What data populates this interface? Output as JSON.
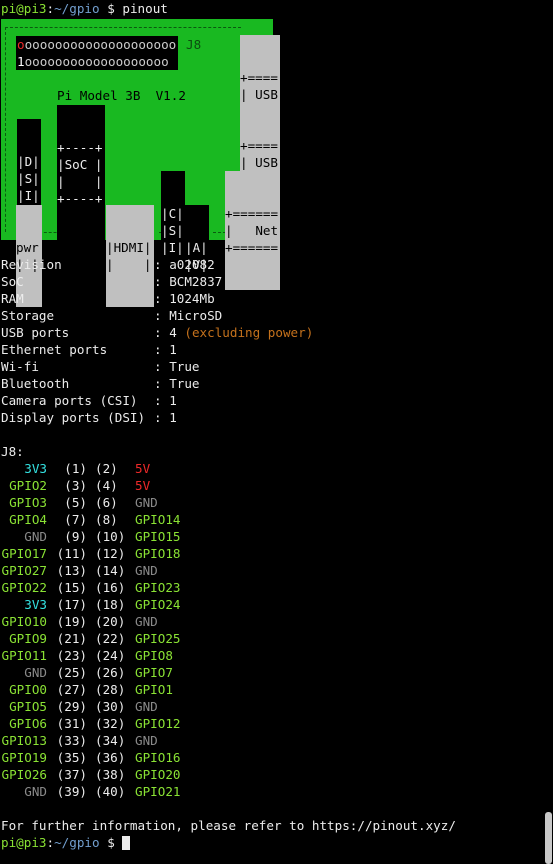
{
  "prompt": {
    "user": "pi@pi3",
    "path": "~/gpio",
    "symbol": "$",
    "command": "pinout"
  },
  "board": {
    "header_label": "J8",
    "top_row_pins": "oooooooooooooooooooo",
    "bottom_row_first": "1",
    "bottom_row_pins": "ooooooooooooooooooo",
    "model": "Pi Model 3B  V1.2",
    "soc_box": [
      "+----+",
      "|SoC |",
      "|    |",
      "+----+"
    ],
    "dsi_box": [
      "|D|",
      "|S|",
      "|I|"
    ],
    "csi_box": [
      "|C|",
      "|S|",
      "|I|"
    ],
    "av_box": [
      "|A|",
      "|V|"
    ],
    "usb_top": [
      "+====",
      "| USB",
      "+===="
    ],
    "usb_bottom": [
      "+====",
      "| USB",
      "+===="
    ],
    "net": [
      "+======",
      "|   Net",
      "+======"
    ],
    "pwr": [
      "pwr",
      "| |"
    ],
    "hdmi": [
      "|HDMI|",
      "|    |"
    ]
  },
  "info": [
    {
      "key": "Revision",
      "value": "a02082"
    },
    {
      "key": "SoC",
      "value": "BCM2837"
    },
    {
      "key": "RAM",
      "value": "1024Mb"
    },
    {
      "key": "Storage",
      "value": "MicroSD"
    },
    {
      "key": "USB ports",
      "value": "4",
      "note": "(excluding power)"
    },
    {
      "key": "Ethernet ports",
      "value": "1"
    },
    {
      "key": "Wi-fi",
      "value": "True"
    },
    {
      "key": "Bluetooth",
      "value": "True"
    },
    {
      "key": "Camera ports (CSI)",
      "value": "1"
    },
    {
      "key": "Display ports (DSI)",
      "value": "1"
    }
  ],
  "info_separator": ":",
  "j8_title": "J8:",
  "pins": [
    {
      "left": "3V3",
      "l_num": "(1)",
      "r_num": "(2)",
      "right": "5V"
    },
    {
      "left": "GPIO2",
      "l_num": "(3)",
      "r_num": "(4)",
      "right": "5V"
    },
    {
      "left": "GPIO3",
      "l_num": "(5)",
      "r_num": "(6)",
      "right": "GND"
    },
    {
      "left": "GPIO4",
      "l_num": "(7)",
      "r_num": "(8)",
      "right": "GPIO14"
    },
    {
      "left": "GND",
      "l_num": "(9)",
      "r_num": "(10)",
      "right": "GPIO15"
    },
    {
      "left": "GPIO17",
      "l_num": "(11)",
      "r_num": "(12)",
      "right": "GPIO18"
    },
    {
      "left": "GPIO27",
      "l_num": "(13)",
      "r_num": "(14)",
      "right": "GND"
    },
    {
      "left": "GPIO22",
      "l_num": "(15)",
      "r_num": "(16)",
      "right": "GPIO23"
    },
    {
      "left": "3V3",
      "l_num": "(17)",
      "r_num": "(18)",
      "right": "GPIO24"
    },
    {
      "left": "GPIO10",
      "l_num": "(19)",
      "r_num": "(20)",
      "right": "GND"
    },
    {
      "left": "GPIO9",
      "l_num": "(21)",
      "r_num": "(22)",
      "right": "GPIO25"
    },
    {
      "left": "GPIO11",
      "l_num": "(23)",
      "r_num": "(24)",
      "right": "GPIO8"
    },
    {
      "left": "GND",
      "l_num": "(25)",
      "r_num": "(26)",
      "right": "GPIO7"
    },
    {
      "left": "GPIO0",
      "l_num": "(27)",
      "r_num": "(28)",
      "right": "GPIO1"
    },
    {
      "left": "GPIO5",
      "l_num": "(29)",
      "r_num": "(30)",
      "right": "GND"
    },
    {
      "left": "GPIO6",
      "l_num": "(31)",
      "r_num": "(32)",
      "right": "GPIO12"
    },
    {
      "left": "GPIO13",
      "l_num": "(33)",
      "r_num": "(34)",
      "right": "GND"
    },
    {
      "left": "GPIO19",
      "l_num": "(35)",
      "r_num": "(36)",
      "right": "GPIO16"
    },
    {
      "left": "GPIO26",
      "l_num": "(37)",
      "r_num": "(38)",
      "right": "GPIO20"
    },
    {
      "left": "GND",
      "l_num": "(39)",
      "r_num": "(40)",
      "right": "GPIO21"
    }
  ],
  "footer": "For further information, please refer to https://pinout.xyz/",
  "colors": {
    "v3": "#34e2e2",
    "v5": "#ef2929",
    "gpio": "#8ae234",
    "gnd": "#8a8a8a",
    "board": "#19b921",
    "prompt_user": "#8ae234",
    "prompt_path": "#729fcf",
    "note": "#c4711c"
  }
}
